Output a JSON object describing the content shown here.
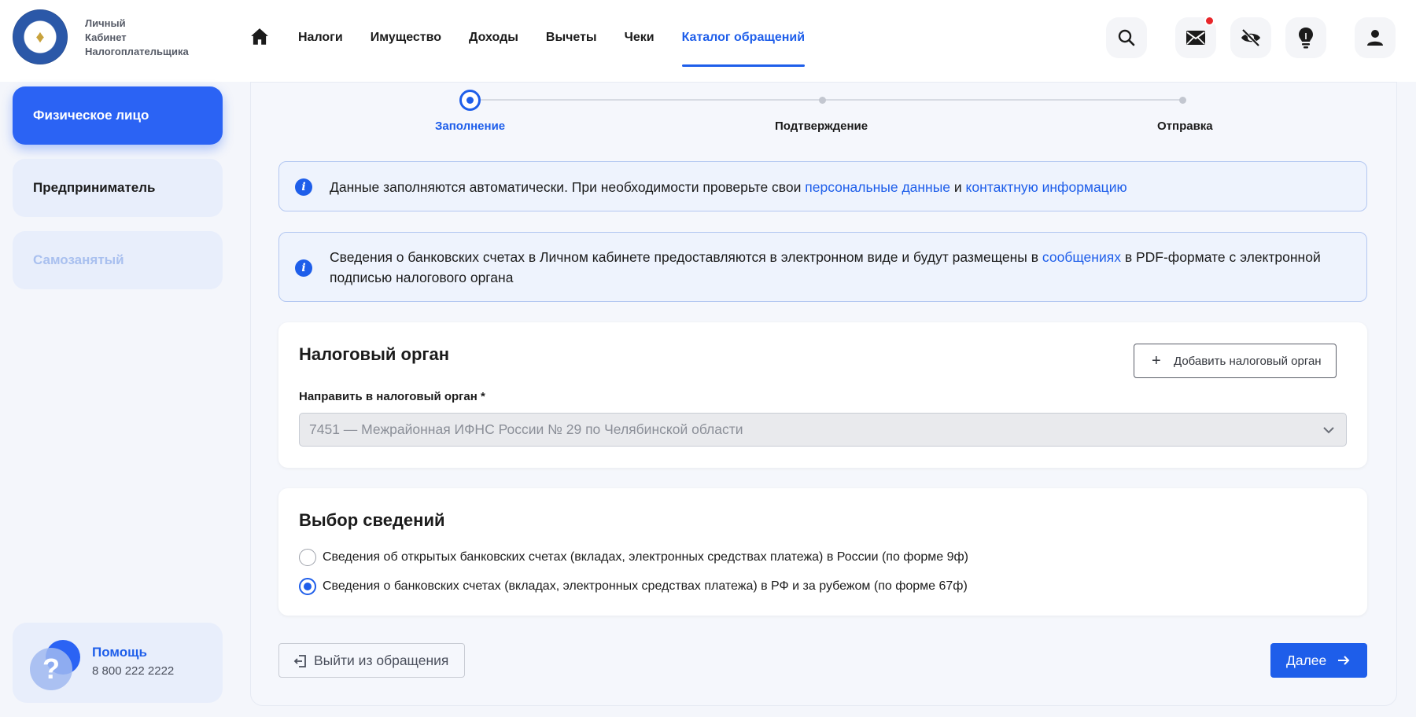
{
  "header": {
    "logo_lines": [
      "Личный",
      "Кабинет",
      "Налогоплательщика"
    ],
    "nav": [
      {
        "label": "Налоги"
      },
      {
        "label": "Имущество"
      },
      {
        "label": "Доходы"
      },
      {
        "label": "Вычеты"
      },
      {
        "label": "Чеки"
      },
      {
        "label": "Каталог обращений",
        "active": true
      }
    ],
    "icons": [
      "home-icon",
      "search-icon",
      "mail-icon",
      "eye-off-icon",
      "lightbulb-icon",
      "user-icon"
    ],
    "has_notification": true
  },
  "sidebar": {
    "items": [
      {
        "label": "Физическое лицо",
        "state": "active"
      },
      {
        "label": "Предприниматель",
        "state": "normal"
      },
      {
        "label": "Самозанятый",
        "state": "disabled"
      }
    ],
    "help": {
      "title": "Помощь",
      "phone": "8 800 222 2222"
    }
  },
  "stepper": {
    "steps": [
      {
        "label": "Заполнение",
        "active": true
      },
      {
        "label": "Подтверждение",
        "active": false
      },
      {
        "label": "Отправка",
        "active": false
      }
    ]
  },
  "info1": {
    "text_before": "Данные заполняются автоматически. При необходимости проверьте свои ",
    "link1": "персональные данные",
    "text_middle": " и ",
    "link2": "контактную информацию"
  },
  "info2": {
    "text_before": "Сведения о банковских счетах в Личном кабинете предоставляются в электронном виде и будут размещены в ",
    "link": "сообщениях",
    "text_after": " в PDF-формате с электронной подписью налогового органа"
  },
  "tax_office": {
    "title": "Налоговый орган",
    "add_button": "Добавить налоговый орган",
    "field_label": "Направить в налоговый орган *",
    "selected_value": "7451 — Межрайонная ИФНС России № 29 по Челябинской области"
  },
  "info_choice": {
    "title": "Выбор сведений",
    "options": [
      {
        "label": "Сведения об открытых банковских счетах (вкладах, электронных средствах платежа) в России (по форме 9ф)",
        "checked": false
      },
      {
        "label": "Сведения о банковских счетах (вкладах, электронных средствах платежа) в РФ и за рубежом (по форме 67ф)",
        "checked": true
      }
    ]
  },
  "actions": {
    "exit": "Выйти из обращения",
    "next": "Далее"
  },
  "colors": {
    "accent": "#1e5eea",
    "sidebar_active": "#2b63f4",
    "notification": "#e8262a"
  }
}
